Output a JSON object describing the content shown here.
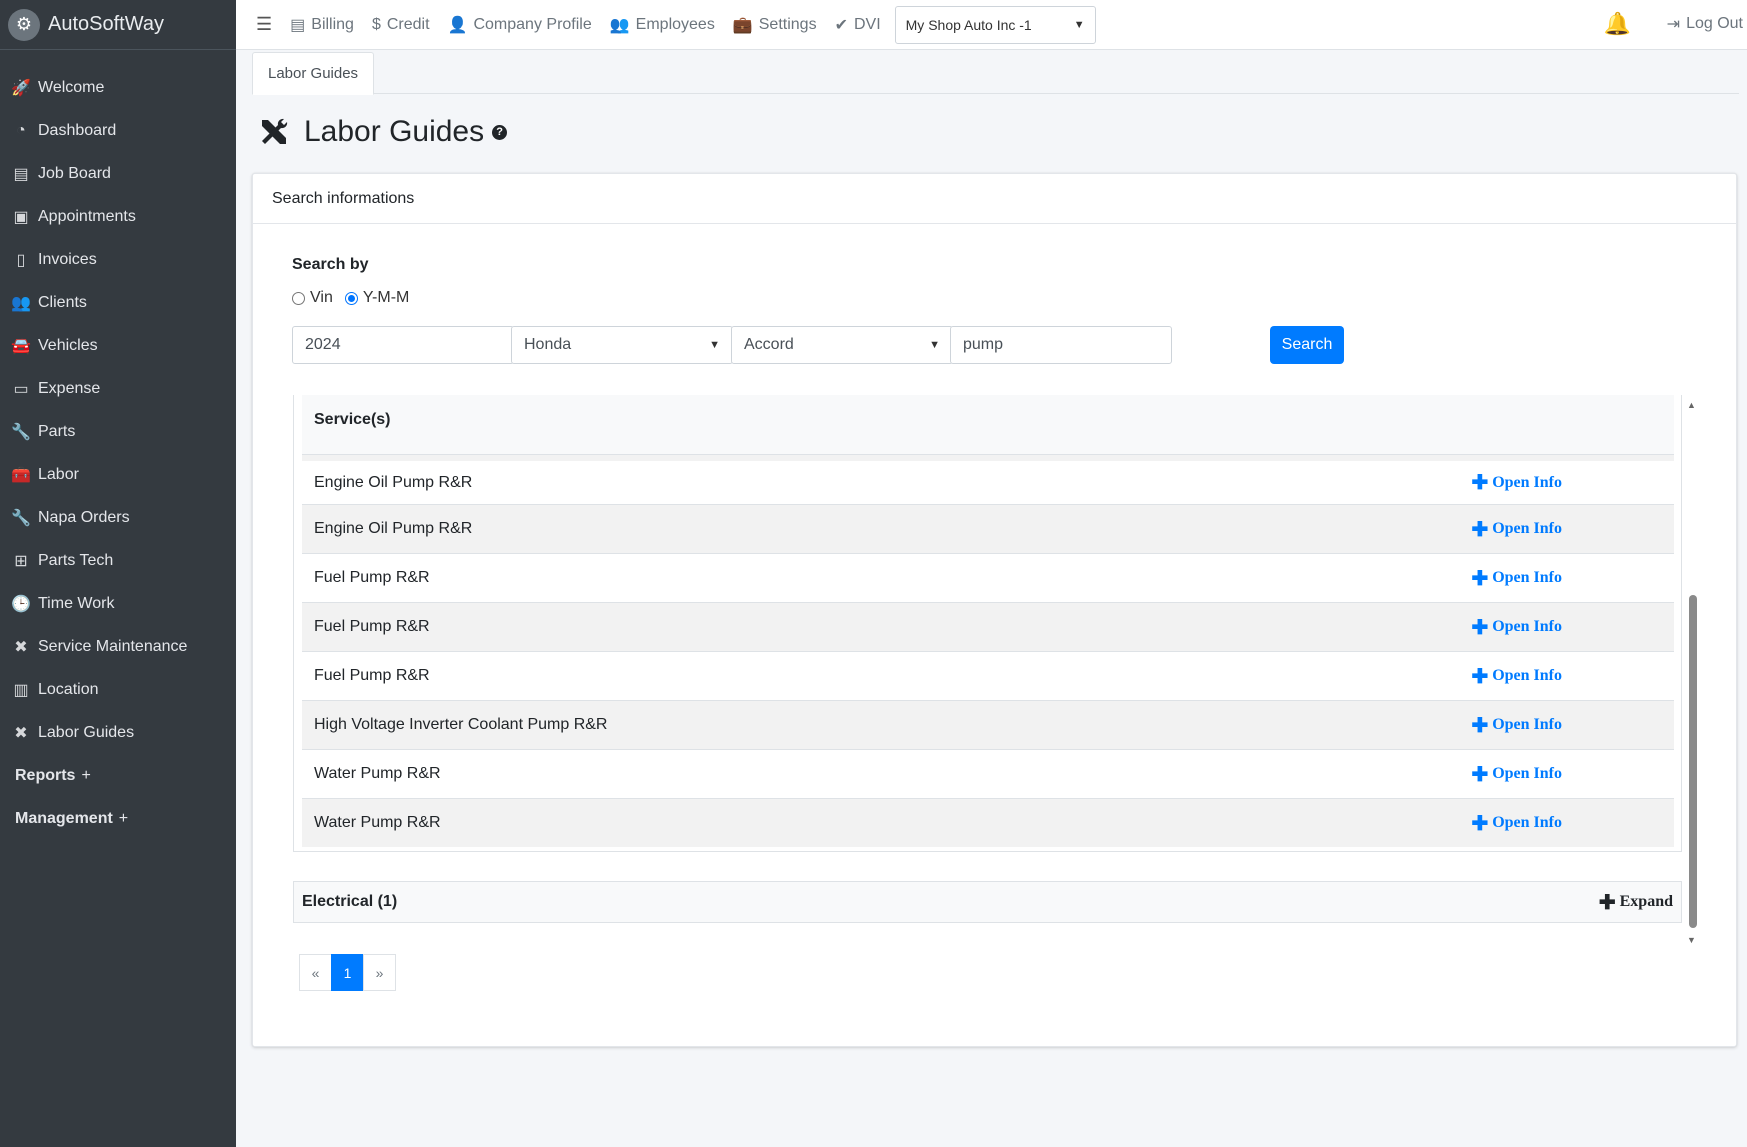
{
  "brand": {
    "name": "AutoSoftWay"
  },
  "sidebar": {
    "items": [
      {
        "label": "Welcome",
        "icon": "rocket-icon"
      },
      {
        "label": "Dashboard",
        "icon": "gauge-icon"
      },
      {
        "label": "Job Board",
        "icon": "cash-register-icon"
      },
      {
        "label": "Appointments",
        "icon": "calendar-check-icon"
      },
      {
        "label": "Invoices",
        "icon": "invoice-icon"
      },
      {
        "label": "Clients",
        "icon": "users-icon"
      },
      {
        "label": "Vehicles",
        "icon": "car-icon"
      },
      {
        "label": "Expense",
        "icon": "money-bill-icon"
      },
      {
        "label": "Parts",
        "icon": "wrench-icon"
      },
      {
        "label": "Labor",
        "icon": "toolbox-icon"
      },
      {
        "label": "Napa Orders",
        "icon": "wrench-icon"
      },
      {
        "label": "Parts Tech",
        "icon": "sitemap-icon"
      },
      {
        "label": "Time Work",
        "icon": "clock-icon"
      },
      {
        "label": "Service Maintenance",
        "icon": "tools-icon"
      },
      {
        "label": "Location",
        "icon": "map-icon"
      },
      {
        "label": "Labor Guides",
        "icon": "tools-icon"
      }
    ],
    "sections": [
      {
        "label": "Reports",
        "toggle": "+"
      },
      {
        "label": "Management",
        "toggle": "+"
      }
    ]
  },
  "topbar": {
    "links": [
      {
        "label": "Billing",
        "icon": "cash-register-icon"
      },
      {
        "label": "Credit",
        "icon": "dollar-icon"
      },
      {
        "label": "Company Profile",
        "icon": "user-icon"
      },
      {
        "label": "Employees",
        "icon": "users-icon"
      },
      {
        "label": "Settings",
        "icon": "briefcase-icon"
      },
      {
        "label": "DVI",
        "icon": "check-icon"
      }
    ],
    "shop_select": "My Shop Auto Inc -1",
    "logout": "Log Out"
  },
  "tabs": [
    {
      "label": "Labor Guides"
    }
  ],
  "page": {
    "title": "Labor Guides",
    "help": "?"
  },
  "card": {
    "header": "Search informations",
    "search_by_label": "Search by",
    "radio_vin": "Vin",
    "radio_ymm": "Y-M-M",
    "selected_mode": "Y-M-M",
    "year": "2024",
    "make": "Honda",
    "model": "Accord",
    "keyword": "pump",
    "search_button": "Search"
  },
  "results": {
    "header": "Service(s)",
    "rows": [
      {
        "service": "Engine Oil Pump R&R",
        "action": "Open Info"
      },
      {
        "service": "Engine Oil Pump R&R",
        "action": "Open Info"
      },
      {
        "service": "Fuel Pump R&R",
        "action": "Open Info"
      },
      {
        "service": "Fuel Pump R&R",
        "action": "Open Info"
      },
      {
        "service": "Fuel Pump R&R",
        "action": "Open Info"
      },
      {
        "service": "High Voltage Inverter Coolant Pump R&R",
        "action": "Open Info"
      },
      {
        "service": "Water Pump R&R",
        "action": "Open Info"
      },
      {
        "service": "Water Pump R&R",
        "action": "Open Info"
      }
    ],
    "group": {
      "label": "Electrical (1)",
      "action": "Expand"
    }
  },
  "pagination": {
    "prev": "«",
    "current": "1",
    "next": "»"
  },
  "colors": {
    "sidebar_bg": "#343a40",
    "primary": "#007bff"
  }
}
